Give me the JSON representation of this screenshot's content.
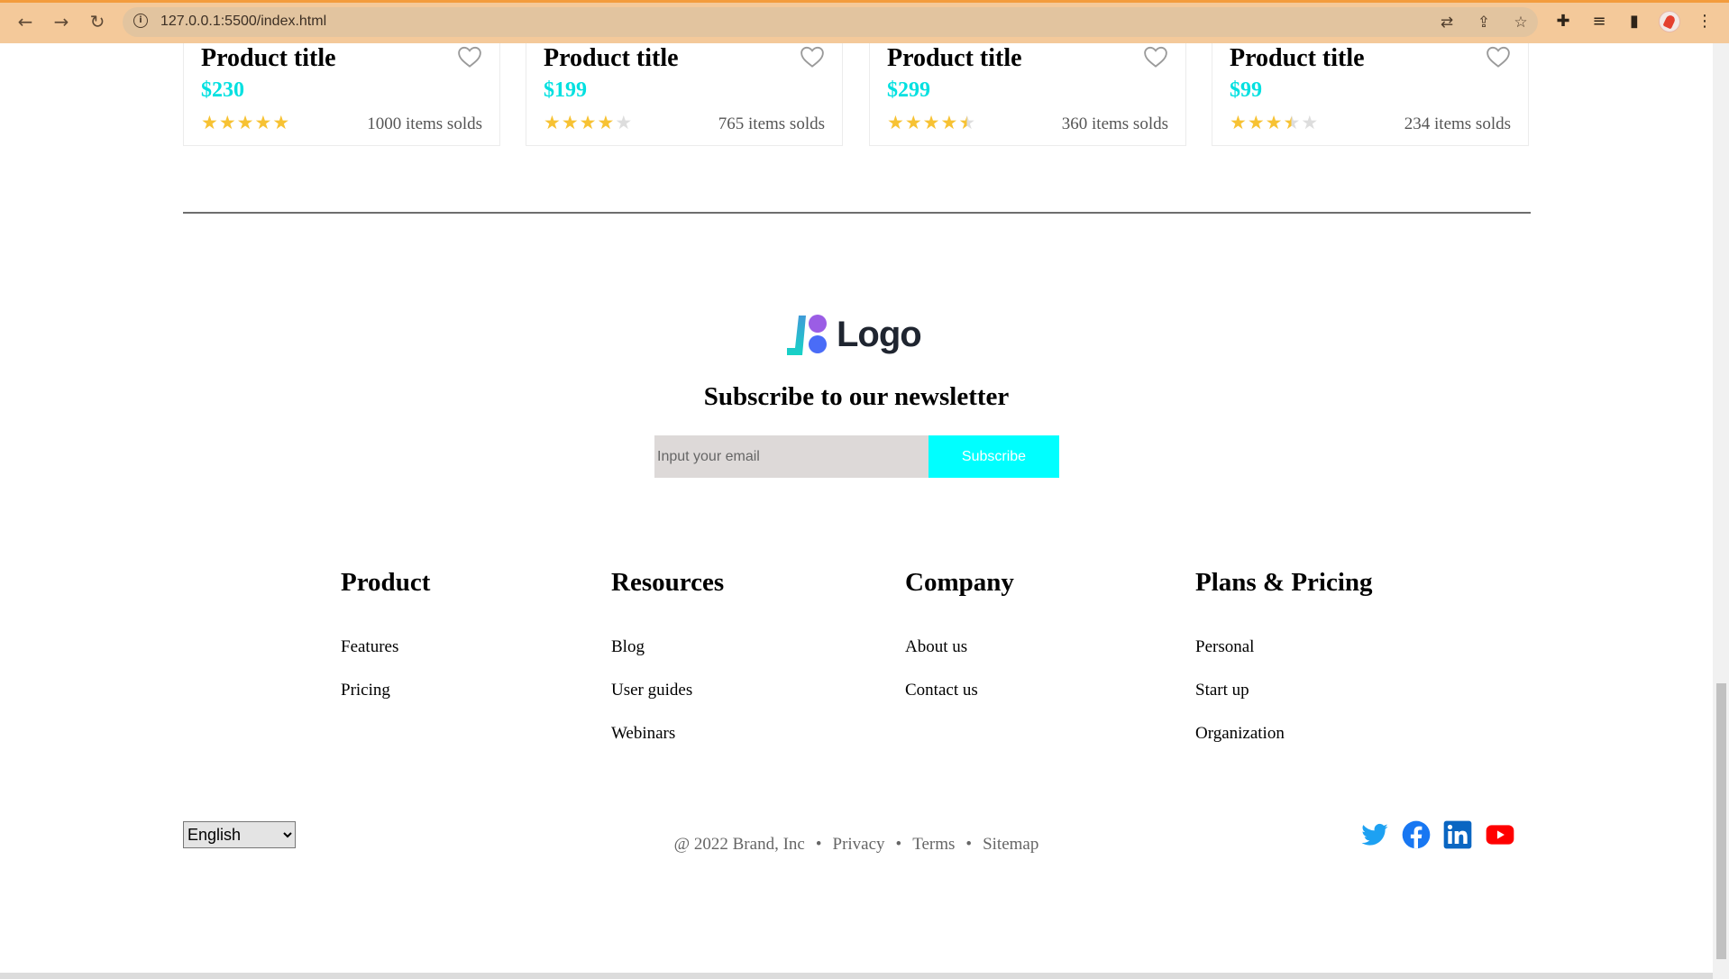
{
  "browser": {
    "url": "127.0.0.1:5500/index.html",
    "accent": "#f4c99a"
  },
  "products": [
    {
      "title": "Product title",
      "price": "$230",
      "rating": 5,
      "sold": "1000 items solds"
    },
    {
      "title": "Product title",
      "price": "$199",
      "rating": 4,
      "sold": "765 items solds"
    },
    {
      "title": "Product title",
      "price": "$299",
      "rating": 4.5,
      "sold": "360 items solds"
    },
    {
      "title": "Product title",
      "price": "$99",
      "rating": 3.5,
      "sold": "234 items solds"
    }
  ],
  "logo": {
    "text": "Logo"
  },
  "newsletter": {
    "title": "Subscribe to our newsletter",
    "placeholder": "Input your email",
    "button": "Subscribe"
  },
  "footer": {
    "columns": [
      {
        "title": "Product",
        "links": [
          "Features",
          "Pricing"
        ]
      },
      {
        "title": "Resources",
        "links": [
          "Blog",
          "User guides",
          "Webinars"
        ]
      },
      {
        "title": "Company",
        "links": [
          "About us",
          "Contact us"
        ]
      },
      {
        "title": "Plans & Pricing",
        "links": [
          "Personal",
          "Start up",
          "Organization"
        ]
      }
    ],
    "language": "English",
    "copyright": "@ 2022 Brand, Inc",
    "legal_links": [
      "Privacy",
      "Terms",
      "Sitemap"
    ],
    "social": [
      "twitter-icon",
      "facebook-icon",
      "linkedin-icon",
      "youtube-icon"
    ]
  },
  "colors": {
    "price": "#00e0e0",
    "subscribe": "#00ffff",
    "star": "#f7c233",
    "star_empty": "#dddddd"
  }
}
